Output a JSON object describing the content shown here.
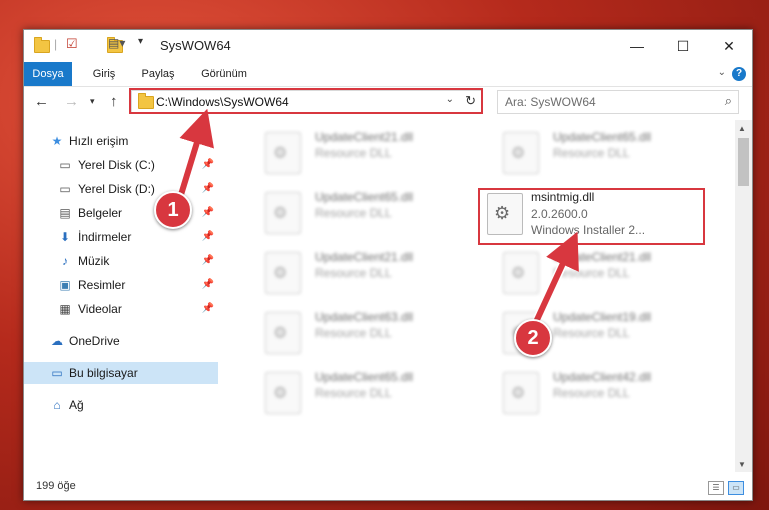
{
  "window": {
    "title": "SysWOW64",
    "minimize": "—",
    "maximize": "☐",
    "close": "✕"
  },
  "ribbon": {
    "tabs": [
      {
        "label": "Dosya",
        "active": true
      },
      {
        "label": "Giriş",
        "active": false
      },
      {
        "label": "Paylaş",
        "active": false
      },
      {
        "label": "Görünüm",
        "active": false
      }
    ],
    "help": "?"
  },
  "nav": {
    "address": "C:\\Windows\\SysWOW64",
    "search_placeholder": "Ara: SysWOW64"
  },
  "sidebar": {
    "items": [
      {
        "label": "Hızlı erişim",
        "icon": "star-icon",
        "pinned": false
      },
      {
        "label": "Yerel Disk (C:)",
        "icon": "drive-icon",
        "pinned": true
      },
      {
        "label": "Yerel Disk (D:)",
        "icon": "drive-icon",
        "pinned": true
      },
      {
        "label": "Belgeler",
        "icon": "document-icon",
        "pinned": true
      },
      {
        "label": "İndirmeler",
        "icon": "download-icon",
        "pinned": true
      },
      {
        "label": "Müzik",
        "icon": "music-icon",
        "pinned": true
      },
      {
        "label": "Resimler",
        "icon": "pictures-icon",
        "pinned": true
      },
      {
        "label": "Videolar",
        "icon": "video-icon",
        "pinned": true
      },
      {
        "label": "OneDrive",
        "icon": "cloud-icon",
        "pinned": false
      },
      {
        "label": "Bu bilgisayar",
        "icon": "computer-icon",
        "pinned": false
      },
      {
        "label": "Ağ",
        "icon": "network-icon",
        "pinned": false
      }
    ]
  },
  "files": {
    "left_column": [
      {
        "name": "UpdateClient21.dll",
        "desc": "Resource DLL"
      },
      {
        "name": "UpdateClient65.dll",
        "desc": "Resource DLL"
      },
      {
        "name": "UpdateClient21.dll",
        "desc": "Resource DLL"
      },
      {
        "name": "UpdateClient63.dll",
        "desc": "Resource DLL"
      },
      {
        "name": "UpdateClient65.dll",
        "desc": "Resource DLL"
      }
    ],
    "right_column": [
      {
        "name": "UpdateClient65.dll",
        "desc": "Resource DLL"
      },
      {
        "name": "UpdateClient21.dll",
        "desc": "Resource DLL"
      },
      {
        "name": "UpdateClient19.dll",
        "desc": "Resource DLL"
      },
      {
        "name": "UpdateClient42.dll",
        "desc": "Resource DLL"
      }
    ],
    "highlighted": {
      "name": "msintmig.dll",
      "version": "2.0.2600.0",
      "type": "Windows Installer 2..."
    }
  },
  "status": {
    "count": "199 öğe"
  },
  "annotations": {
    "badge1": "1",
    "badge2": "2"
  },
  "colors": {
    "accent": "#1979ca",
    "highlight": "#d8373f",
    "selection": "#cce4f7"
  }
}
